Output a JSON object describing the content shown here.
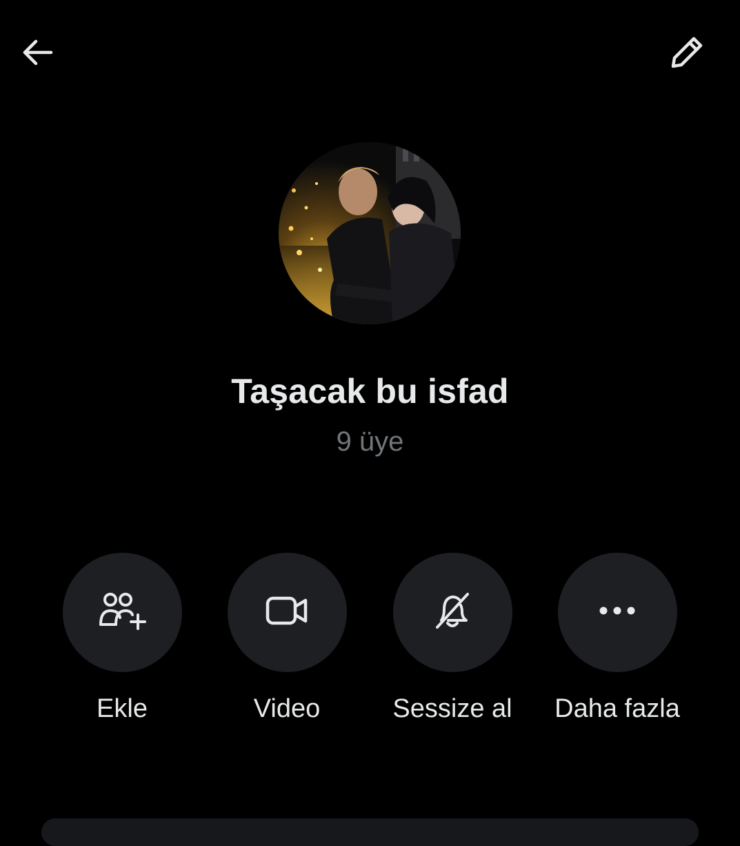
{
  "header": {
    "back_icon": "arrow-left-icon",
    "edit_icon": "pencil-icon"
  },
  "group": {
    "title": "Taşacak bu isfad",
    "member_count": "9 üye",
    "avatar": "group-photo-couple-on-balcony-at-night"
  },
  "actions": [
    {
      "label": "Ekle",
      "icon": "add-people-icon"
    },
    {
      "label": "Video",
      "icon": "video-camera-icon"
    },
    {
      "label": "Sessize al",
      "icon": "bell-muted-icon"
    },
    {
      "label": "Daha fazla",
      "icon": "more-horizontal-icon"
    }
  ],
  "colors": {
    "background": "#000000",
    "primary_text": "#e7e9ea",
    "secondary_text": "#71767b",
    "action_circle": "#1d1f22"
  }
}
